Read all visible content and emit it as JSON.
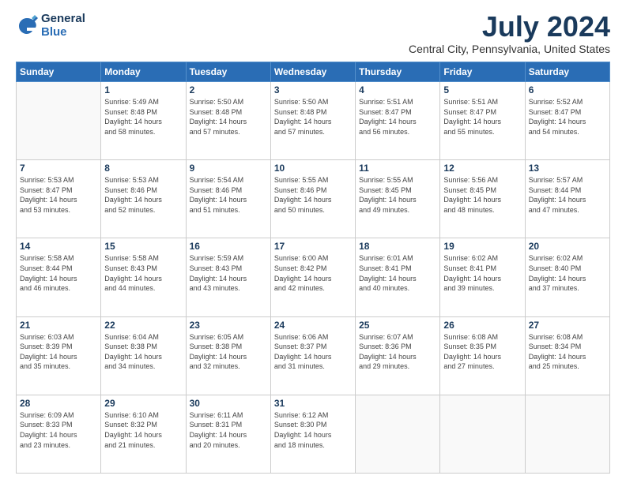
{
  "logo": {
    "general": "General",
    "blue": "Blue"
  },
  "title": "July 2024",
  "location": "Central City, Pennsylvania, United States",
  "days_of_week": [
    "Sunday",
    "Monday",
    "Tuesday",
    "Wednesday",
    "Thursday",
    "Friday",
    "Saturday"
  ],
  "weeks": [
    [
      {
        "day": "",
        "info": ""
      },
      {
        "day": "1",
        "info": "Sunrise: 5:49 AM\nSunset: 8:48 PM\nDaylight: 14 hours\nand 58 minutes."
      },
      {
        "day": "2",
        "info": "Sunrise: 5:50 AM\nSunset: 8:48 PM\nDaylight: 14 hours\nand 57 minutes."
      },
      {
        "day": "3",
        "info": "Sunrise: 5:50 AM\nSunset: 8:48 PM\nDaylight: 14 hours\nand 57 minutes."
      },
      {
        "day": "4",
        "info": "Sunrise: 5:51 AM\nSunset: 8:47 PM\nDaylight: 14 hours\nand 56 minutes."
      },
      {
        "day": "5",
        "info": "Sunrise: 5:51 AM\nSunset: 8:47 PM\nDaylight: 14 hours\nand 55 minutes."
      },
      {
        "day": "6",
        "info": "Sunrise: 5:52 AM\nSunset: 8:47 PM\nDaylight: 14 hours\nand 54 minutes."
      }
    ],
    [
      {
        "day": "7",
        "info": "Sunrise: 5:53 AM\nSunset: 8:47 PM\nDaylight: 14 hours\nand 53 minutes."
      },
      {
        "day": "8",
        "info": "Sunrise: 5:53 AM\nSunset: 8:46 PM\nDaylight: 14 hours\nand 52 minutes."
      },
      {
        "day": "9",
        "info": "Sunrise: 5:54 AM\nSunset: 8:46 PM\nDaylight: 14 hours\nand 51 minutes."
      },
      {
        "day": "10",
        "info": "Sunrise: 5:55 AM\nSunset: 8:46 PM\nDaylight: 14 hours\nand 50 minutes."
      },
      {
        "day": "11",
        "info": "Sunrise: 5:55 AM\nSunset: 8:45 PM\nDaylight: 14 hours\nand 49 minutes."
      },
      {
        "day": "12",
        "info": "Sunrise: 5:56 AM\nSunset: 8:45 PM\nDaylight: 14 hours\nand 48 minutes."
      },
      {
        "day": "13",
        "info": "Sunrise: 5:57 AM\nSunset: 8:44 PM\nDaylight: 14 hours\nand 47 minutes."
      }
    ],
    [
      {
        "day": "14",
        "info": "Sunrise: 5:58 AM\nSunset: 8:44 PM\nDaylight: 14 hours\nand 46 minutes."
      },
      {
        "day": "15",
        "info": "Sunrise: 5:58 AM\nSunset: 8:43 PM\nDaylight: 14 hours\nand 44 minutes."
      },
      {
        "day": "16",
        "info": "Sunrise: 5:59 AM\nSunset: 8:43 PM\nDaylight: 14 hours\nand 43 minutes."
      },
      {
        "day": "17",
        "info": "Sunrise: 6:00 AM\nSunset: 8:42 PM\nDaylight: 14 hours\nand 42 minutes."
      },
      {
        "day": "18",
        "info": "Sunrise: 6:01 AM\nSunset: 8:41 PM\nDaylight: 14 hours\nand 40 minutes."
      },
      {
        "day": "19",
        "info": "Sunrise: 6:02 AM\nSunset: 8:41 PM\nDaylight: 14 hours\nand 39 minutes."
      },
      {
        "day": "20",
        "info": "Sunrise: 6:02 AM\nSunset: 8:40 PM\nDaylight: 14 hours\nand 37 minutes."
      }
    ],
    [
      {
        "day": "21",
        "info": "Sunrise: 6:03 AM\nSunset: 8:39 PM\nDaylight: 14 hours\nand 35 minutes."
      },
      {
        "day": "22",
        "info": "Sunrise: 6:04 AM\nSunset: 8:38 PM\nDaylight: 14 hours\nand 34 minutes."
      },
      {
        "day": "23",
        "info": "Sunrise: 6:05 AM\nSunset: 8:38 PM\nDaylight: 14 hours\nand 32 minutes."
      },
      {
        "day": "24",
        "info": "Sunrise: 6:06 AM\nSunset: 8:37 PM\nDaylight: 14 hours\nand 31 minutes."
      },
      {
        "day": "25",
        "info": "Sunrise: 6:07 AM\nSunset: 8:36 PM\nDaylight: 14 hours\nand 29 minutes."
      },
      {
        "day": "26",
        "info": "Sunrise: 6:08 AM\nSunset: 8:35 PM\nDaylight: 14 hours\nand 27 minutes."
      },
      {
        "day": "27",
        "info": "Sunrise: 6:08 AM\nSunset: 8:34 PM\nDaylight: 14 hours\nand 25 minutes."
      }
    ],
    [
      {
        "day": "28",
        "info": "Sunrise: 6:09 AM\nSunset: 8:33 PM\nDaylight: 14 hours\nand 23 minutes."
      },
      {
        "day": "29",
        "info": "Sunrise: 6:10 AM\nSunset: 8:32 PM\nDaylight: 14 hours\nand 21 minutes."
      },
      {
        "day": "30",
        "info": "Sunrise: 6:11 AM\nSunset: 8:31 PM\nDaylight: 14 hours\nand 20 minutes."
      },
      {
        "day": "31",
        "info": "Sunrise: 6:12 AM\nSunset: 8:30 PM\nDaylight: 14 hours\nand 18 minutes."
      },
      {
        "day": "",
        "info": ""
      },
      {
        "day": "",
        "info": ""
      },
      {
        "day": "",
        "info": ""
      }
    ]
  ]
}
